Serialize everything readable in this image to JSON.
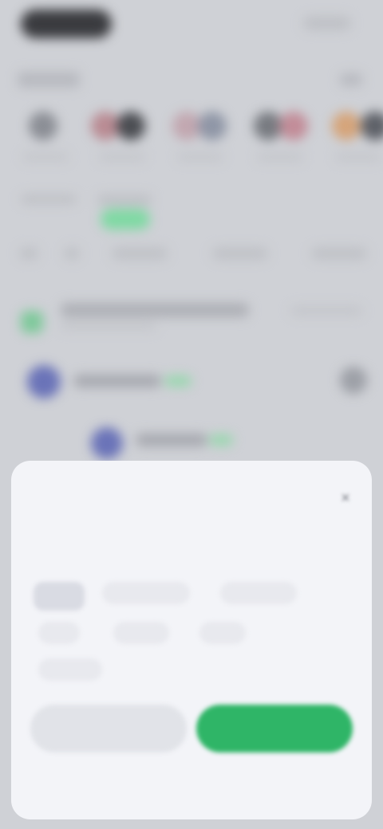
{
  "colors": {
    "accent": "#2fb567",
    "avatar": "#6a73b8",
    "background": "#cfd1d6",
    "sheet": "#f3f4f8"
  },
  "icons": {
    "close": "close-icon"
  },
  "sheet": {
    "title": "",
    "section_label": "",
    "options": [
      "",
      "",
      "",
      "",
      "",
      "",
      ""
    ],
    "secondary_button_label": "",
    "primary_button_label": ""
  }
}
